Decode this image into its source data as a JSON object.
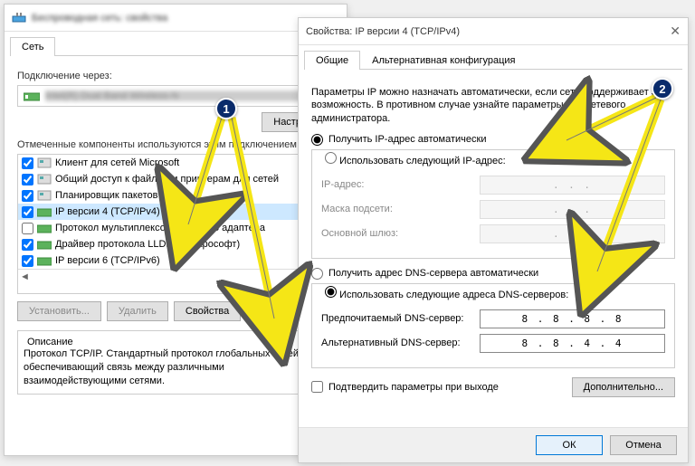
{
  "window1": {
    "title": "Беспроводная сеть: свойства",
    "tabs": {
      "network": "Сеть"
    },
    "connect_via": "Подключение через:",
    "adapter": "Intel(R) Dual Band Wireless-N",
    "configure": "Настроить",
    "components_label": "Отмеченные компоненты используются этим подключением:",
    "items": [
      {
        "label": "Клиент для сетей Microsoft",
        "checked": true
      },
      {
        "label": "Общий доступ к файлам и принтерам для сетей",
        "checked": true
      },
      {
        "label": "Планировщик пакетов QoS",
        "checked": true
      },
      {
        "label": "IP версии 4 (TCP/IPv4)",
        "checked": true,
        "selected": true
      },
      {
        "label": "Протокол мультиплексора сетевого адаптера",
        "checked": false
      },
      {
        "label": "Драйвер протокола LLDP (Майкрософт)",
        "checked": true
      },
      {
        "label": "IP версии 6 (TCP/IPv6)",
        "checked": true
      }
    ],
    "install": "Установить...",
    "uninstall": "Удалить",
    "properties": "Свойства",
    "desc_title": "Описание",
    "desc": "Протокол TCP/IP. Стандартный протокол глобальных сетей, обеспечивающий связь между различными взаимодействующими сетями."
  },
  "window2": {
    "title": "Свойства: IP версии 4 (TCP/IPv4)",
    "tabs": {
      "general": "Общие",
      "alt": "Альтернативная конфигурация"
    },
    "info": "Параметры IP можно назначать автоматически, если сеть поддерживает эту возможность. В противном случае узнайте параметры IP у сетевого администратора.",
    "radio_auto_ip": "Получить IP-адрес автоматически",
    "radio_manual_ip": "Использовать следующий IP-адрес:",
    "ip_addr": "IP-адрес:",
    "mask": "Маска подсети:",
    "gateway": "Основной шлюз:",
    "radio_auto_dns": "Получить адрес DNS-сервера автоматически",
    "radio_manual_dns": "Использовать следующие адреса DNS-серверов:",
    "dns1_label": "Предпочитаемый DNS-сервер:",
    "dns2_label": "Альтернативный DNS-сервер:",
    "dns1": "8 . 8 . 8 . 8",
    "dns2": "8 . 8 . 4 . 4",
    "confirm": "Подтвердить параметры при выходе",
    "advanced": "Дополнительно...",
    "ok": "ОК",
    "cancel": "Отмена"
  },
  "dots": ".   .   ."
}
